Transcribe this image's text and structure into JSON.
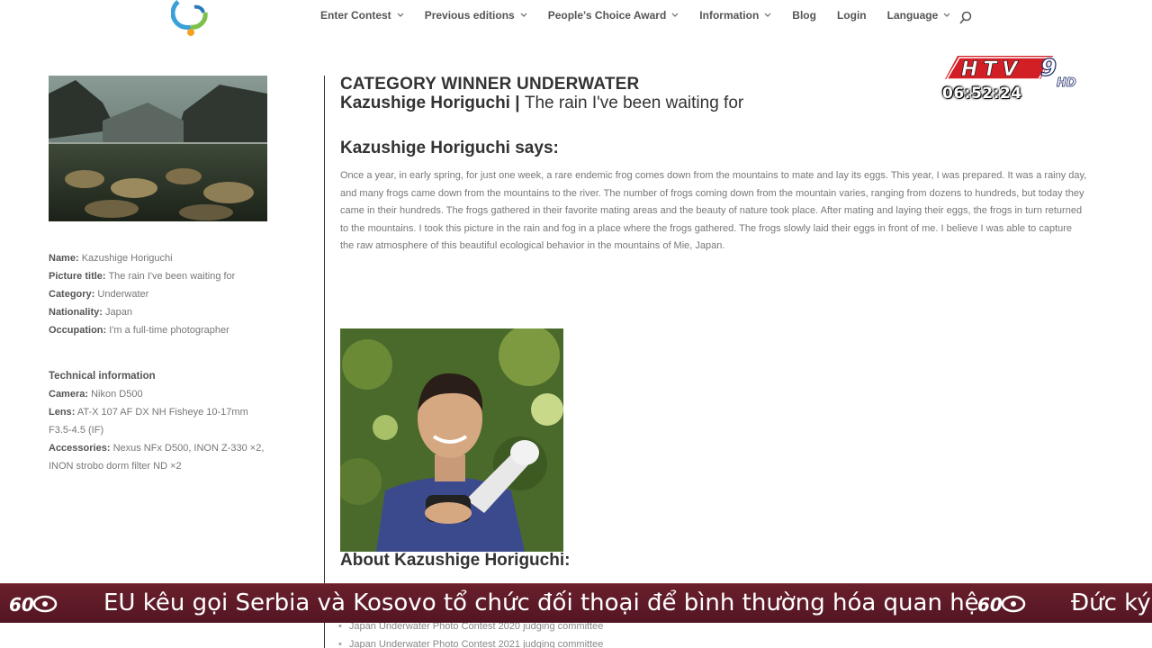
{
  "nav": {
    "items": [
      {
        "label": "Enter Contest",
        "dropdown": true
      },
      {
        "label": "Previous editions",
        "dropdown": true
      },
      {
        "label": "People's Choice Award",
        "dropdown": true
      },
      {
        "label": "Information",
        "dropdown": true
      },
      {
        "label": "Blog",
        "dropdown": false
      },
      {
        "label": "Login",
        "dropdown": false
      },
      {
        "label": "Language",
        "dropdown": true
      }
    ],
    "search_icon": "search-icon"
  },
  "sidebar": {
    "basic": [
      {
        "key": "Name",
        "value": "Kazushige Horiguchi"
      },
      {
        "key": "Picture title",
        "value": "The rain I've been waiting for"
      },
      {
        "key": "Category",
        "value": "Underwater"
      },
      {
        "key": "Nationality",
        "value": "Japan"
      },
      {
        "key": "Occupation",
        "value": "I'm a full-time photographer"
      }
    ],
    "tech_heading": "Technical information",
    "tech": [
      {
        "key": "Camera",
        "value": "Nikon D500"
      },
      {
        "key": "Lens",
        "value": "AT-X 107 AF DX NH Fisheye 10-17mm F3.5-4.5 (IF)"
      },
      {
        "key": "Accessories",
        "value": "Nexus NFx D500, INON Z-330 ×2, INON strobo dorm filter ND ×2"
      }
    ]
  },
  "main": {
    "category_heading": "CATEGORY WINNER UNDERWATER",
    "photographer": "Kazushige Horiguchi",
    "separator": " | ",
    "title": "The rain I've been waiting for",
    "says_heading": "Kazushige Horiguchi says:",
    "story": "Once a year, in early spring, for just one week, a rare endemic frog comes down from the mountains to mate and lay its eggs. This year, I was prepared. It was a rainy day, and many frogs came down from the mountains to the river. The number of frogs coming down from the mountain varies, ranging from dozens to hundreds, but today they came in their hundreds. The frogs gathered in their favorite mating areas and the beauty of nature took place. After mating and laying their eggs, the frogs in turn returned to the mountains. I took this picture in the rain and fog in a place where the frogs gathered. The frogs slowly laid their eggs in front of me. I believe I was able to capture the raw atmosphere of this beautiful ecological behavior in the mountains of Mie, Japan.",
    "about_heading": "About Kazushige Horiguchi:",
    "about_items": [
      "Japan Underwater Photo Contest 2020 judging committee",
      "Japan Underwater Photo Contest 2021 judging committee"
    ]
  },
  "overlay": {
    "channel_logo": "HTV9 HD",
    "channel_letters": "HTV",
    "channel_number": "9",
    "channel_hd": "HD",
    "clock": "06:52:24",
    "ticker_text": "EU kêu gọi Serbia và Kosovo tổ chức đối thoại để bình thường hóa quan hệ",
    "ticker_next": "Đức ký",
    "ticker_logo": "60s-logo-icon",
    "ticker_color": "#5e1a27"
  }
}
